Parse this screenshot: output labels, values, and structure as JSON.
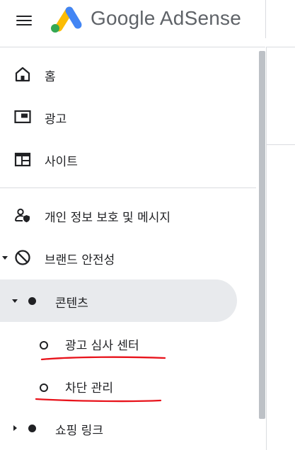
{
  "app": {
    "brand": "Google AdSense"
  },
  "nav": {
    "home": "홈",
    "ads": "광고",
    "sites": "사이트",
    "privacy": "개인 정보 보호 및 메시지",
    "brand_safety": "브랜드 안전성",
    "content": "콘텐츠",
    "ad_review_center": "광고 심사 센터",
    "blocking_controls": "차단 관리",
    "shopping_links": "쇼핑 링크"
  },
  "colors": {
    "logo_yellow": "#fbbc04",
    "logo_blue": "#4285f4",
    "logo_green": "#34a853",
    "annotation_red": "#e8131b",
    "active_bg": "#e8eaed"
  }
}
